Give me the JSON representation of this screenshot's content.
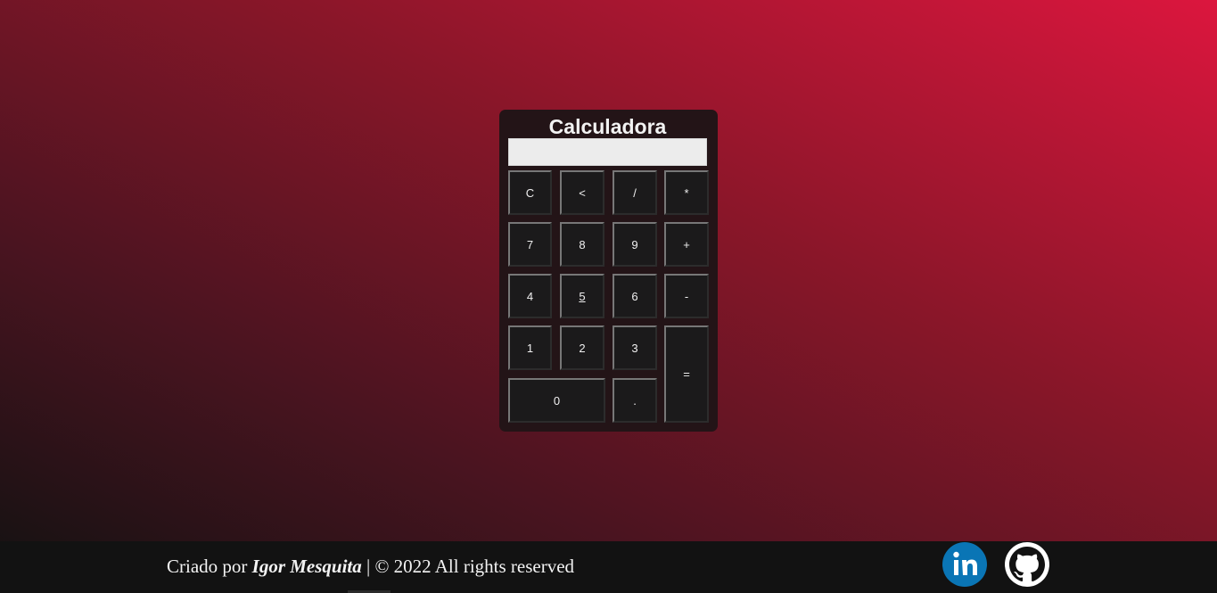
{
  "calculator": {
    "title": "Calculadora",
    "display_value": "",
    "keys": [
      {
        "label": "C",
        "name": "clear-button"
      },
      {
        "label": "<",
        "name": "backspace-button"
      },
      {
        "label": "/",
        "name": "divide-button"
      },
      {
        "label": "*",
        "name": "multiply-button"
      },
      {
        "label": "7",
        "name": "digit-7-button"
      },
      {
        "label": "8",
        "name": "digit-8-button"
      },
      {
        "label": "9",
        "name": "digit-9-button"
      },
      {
        "label": "+",
        "name": "add-button"
      },
      {
        "label": "4",
        "name": "digit-4-button"
      },
      {
        "label": "5",
        "name": "digit-5-button"
      },
      {
        "label": "6",
        "name": "digit-6-button"
      },
      {
        "label": "-",
        "name": "subtract-button"
      },
      {
        "label": "1",
        "name": "digit-1-button"
      },
      {
        "label": "2",
        "name": "digit-2-button"
      },
      {
        "label": "3",
        "name": "digit-3-button"
      },
      {
        "label": "=",
        "name": "equals-button"
      },
      {
        "label": "0",
        "name": "digit-0-button"
      },
      {
        "label": ".",
        "name": "decimal-button"
      }
    ]
  },
  "footer": {
    "prefix": "Criado por ",
    "author": "Igor Mesquita",
    "suffix": " | © 2022 All rights reserved",
    "social": [
      {
        "icon": "linkedin-icon",
        "label": "in",
        "color": "#0a75b5"
      },
      {
        "icon": "github-icon",
        "color": "#ffffff"
      }
    ]
  },
  "colors": {
    "gradient_dark": "#111111",
    "gradient_accent": "#dc163e",
    "calculator_bg": "#231417",
    "key_bg": "#1b1a1b",
    "display_bg": "#ececec",
    "footer_bg": "#121212"
  }
}
